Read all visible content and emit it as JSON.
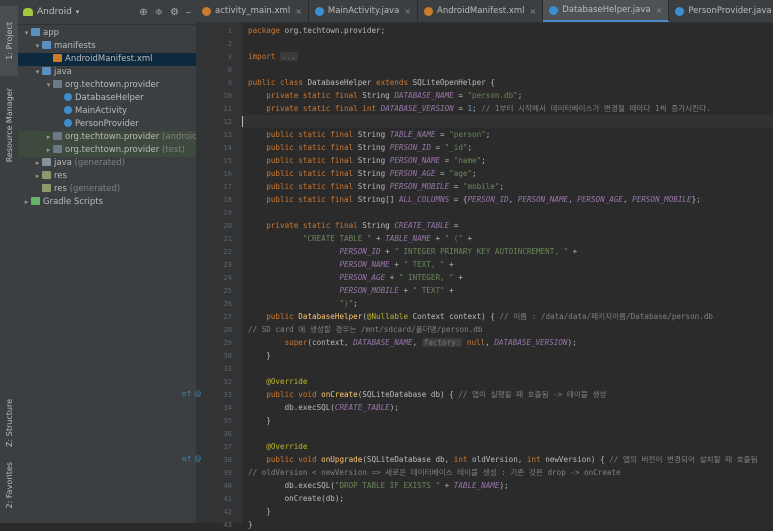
{
  "sidebar_tabs": {
    "project": "1: Project",
    "resource_manager": "Resource Manager",
    "structure": "Z: Structure",
    "favorites": "2: Favorites"
  },
  "project_panel": {
    "view_selector": "Android",
    "tree": [
      {
        "label": "app",
        "indent": 0,
        "arrow": "▾",
        "icon": "folder blue"
      },
      {
        "label": "manifests",
        "indent": 1,
        "arrow": "▾",
        "icon": "folder blue"
      },
      {
        "label": "AndroidManifest.xml",
        "indent": 2,
        "arrow": "",
        "icon": "xml",
        "selected": true
      },
      {
        "label": "java",
        "indent": 1,
        "arrow": "▾",
        "icon": "folder blue"
      },
      {
        "label": "org.techtown.provider",
        "indent": 2,
        "arrow": "▾",
        "icon": "pkg"
      },
      {
        "label": "DatabaseHelper",
        "indent": 3,
        "arrow": "",
        "icon": "cls"
      },
      {
        "label": "MainActivity",
        "indent": 3,
        "arrow": "",
        "icon": "cls"
      },
      {
        "label": "PersonProvider",
        "indent": 3,
        "arrow": "",
        "icon": "cls"
      },
      {
        "label": "org.techtown.provider",
        "suffix": "(androidTest)",
        "indent": 2,
        "arrow": "▸",
        "icon": "pkg",
        "gray": true
      },
      {
        "label": "org.techtown.provider",
        "suffix": "(test)",
        "indent": 2,
        "arrow": "▸",
        "icon": "pkg",
        "gray": true
      },
      {
        "label": "java",
        "suffix": "(generated)",
        "indent": 1,
        "arrow": "▸",
        "icon": "folder"
      },
      {
        "label": "res",
        "indent": 1,
        "arrow": "▸",
        "icon": "res"
      },
      {
        "label": "res",
        "suffix": "(generated)",
        "indent": 1,
        "arrow": "",
        "icon": "res"
      },
      {
        "label": "Gradle Scripts",
        "indent": 0,
        "arrow": "▸",
        "icon": "gradle"
      }
    ]
  },
  "tabs": [
    {
      "label": "activity_main.xml",
      "color": "#c97c2b"
    },
    {
      "label": "MainActivity.java",
      "color": "#3b8ed0"
    },
    {
      "label": "AndroidManifest.xml",
      "color": "#c97c2b"
    },
    {
      "label": "DatabaseHelper.java",
      "color": "#3b8ed0",
      "active": true
    },
    {
      "label": "PersonProvider.java",
      "color": "#3b8ed0"
    }
  ],
  "code_lines": [
    {
      "n": "1",
      "parts": [
        [
          "kw",
          "package "
        ],
        [
          "",
          "org.techtown.provider;"
        ]
      ]
    },
    {
      "n": "2",
      "parts": []
    },
    {
      "n": "3",
      "parts": [
        [
          "kw",
          "import "
        ],
        [
          "hint",
          "..."
        ]
      ]
    },
    {
      "n": "8",
      "parts": []
    },
    {
      "n": "9",
      "parts": [
        [
          "kw",
          "public class "
        ],
        [
          "",
          "DatabaseHelper "
        ],
        [
          "kw",
          "extends "
        ],
        [
          "",
          "SQLiteOpenHelper {"
        ]
      ]
    },
    {
      "n": "10",
      "parts": [
        [
          "kw",
          "    private static final "
        ],
        [
          "",
          "String "
        ],
        [
          "cst",
          "DATABASE_NAME"
        ],
        [
          "",
          " = "
        ],
        [
          "str",
          "\"person.db\""
        ],
        [
          "",
          ";"
        ]
      ]
    },
    {
      "n": "11",
      "parts": [
        [
          "kw",
          "    private static final int "
        ],
        [
          "cst",
          "DATABASE_VERSION"
        ],
        [
          "",
          " = "
        ],
        [
          "num",
          "1"
        ],
        [
          "",
          ";"
        ],
        [
          "cm",
          " // 1부터 시작해서 데이터베이스가 변경될 때마다 1씩 증가시킨다."
        ]
      ]
    },
    {
      "n": "12",
      "parts": [],
      "current": true
    },
    {
      "n": "13",
      "parts": [
        [
          "kw",
          "    public static final "
        ],
        [
          "",
          "String "
        ],
        [
          "cst",
          "TABLE_NAME"
        ],
        [
          "",
          " = "
        ],
        [
          "str",
          "\"person\""
        ],
        [
          "",
          ";"
        ]
      ]
    },
    {
      "n": "14",
      "parts": [
        [
          "kw",
          "    public static final "
        ],
        [
          "",
          "String "
        ],
        [
          "cst",
          "PERSON_ID"
        ],
        [
          "",
          " = "
        ],
        [
          "str",
          "\"_id\""
        ],
        [
          "",
          ";"
        ]
      ]
    },
    {
      "n": "15",
      "parts": [
        [
          "kw",
          "    public static final "
        ],
        [
          "",
          "String "
        ],
        [
          "cst",
          "PERSON_NAME"
        ],
        [
          "",
          " = "
        ],
        [
          "str",
          "\"name\""
        ],
        [
          "",
          ";"
        ]
      ]
    },
    {
      "n": "16",
      "parts": [
        [
          "kw",
          "    public static final "
        ],
        [
          "",
          "String "
        ],
        [
          "cst",
          "PERSON_AGE"
        ],
        [
          "",
          " = "
        ],
        [
          "str",
          "\"age\""
        ],
        [
          "",
          ";"
        ]
      ]
    },
    {
      "n": "17",
      "parts": [
        [
          "kw",
          "    public static final "
        ],
        [
          "",
          "String "
        ],
        [
          "cst",
          "PERSON_MOBILE"
        ],
        [
          "",
          " = "
        ],
        [
          "str",
          "\"mobile\""
        ],
        [
          "",
          ";"
        ]
      ]
    },
    {
      "n": "18",
      "parts": [
        [
          "kw",
          "    public static final "
        ],
        [
          "",
          "String[] "
        ],
        [
          "cst",
          "ALL_COLUMNS"
        ],
        [
          "",
          " = {"
        ],
        [
          "cst",
          "PERSON_ID"
        ],
        [
          "",
          ", "
        ],
        [
          "cst",
          "PERSON_NAME"
        ],
        [
          "",
          ", "
        ],
        [
          "cst",
          "PERSON_AGE"
        ],
        [
          "",
          ", "
        ],
        [
          "cst",
          "PERSON_MOBILE"
        ],
        [
          "",
          "};"
        ]
      ]
    },
    {
      "n": "19",
      "parts": []
    },
    {
      "n": "20",
      "parts": [
        [
          "kw",
          "    private static final "
        ],
        [
          "",
          "String "
        ],
        [
          "cst",
          "CREATE_TABLE"
        ],
        [
          "",
          " ="
        ]
      ]
    },
    {
      "n": "21",
      "parts": [
        [
          "",
          "            "
        ],
        [
          "str",
          "\"CREATE TABLE \""
        ],
        [
          "",
          " + "
        ],
        [
          "cst",
          "TABLE_NAME"
        ],
        [
          "",
          " + "
        ],
        [
          "str",
          "\" (\""
        ],
        [
          "",
          " +"
        ]
      ]
    },
    {
      "n": "22",
      "parts": [
        [
          "",
          "                    "
        ],
        [
          "cst",
          "PERSON_ID"
        ],
        [
          "",
          " + "
        ],
        [
          "str",
          "\" INTEGER PRIMARY KEY AUTOINCREMENT, \""
        ],
        [
          "",
          " +"
        ]
      ]
    },
    {
      "n": "23",
      "parts": [
        [
          "",
          "                    "
        ],
        [
          "cst",
          "PERSON_NAME"
        ],
        [
          "",
          " + "
        ],
        [
          "str",
          "\" TEXT, \""
        ],
        [
          "",
          " +"
        ]
      ]
    },
    {
      "n": "24",
      "parts": [
        [
          "",
          "                    "
        ],
        [
          "cst",
          "PERSON_AGE"
        ],
        [
          "",
          " + "
        ],
        [
          "str",
          "\" INTEGER, \""
        ],
        [
          "",
          " +"
        ]
      ]
    },
    {
      "n": "25",
      "parts": [
        [
          "",
          "                    "
        ],
        [
          "cst",
          "PERSON_MOBILE"
        ],
        [
          "",
          " + "
        ],
        [
          "str",
          "\" TEXT\""
        ],
        [
          "",
          " +"
        ]
      ]
    },
    {
      "n": "26",
      "parts": [
        [
          "",
          "                    "
        ],
        [
          "str",
          "\")\""
        ],
        [
          "",
          ";"
        ]
      ]
    },
    {
      "n": "27",
      "parts": [
        [
          "kw",
          "    public "
        ],
        [
          "fn",
          "DatabaseHelper"
        ],
        [
          "",
          "("
        ],
        [
          "ann",
          "@Nullable "
        ],
        [
          "",
          "Context context) {"
        ],
        [
          "cm",
          " // 이름 : /data/data/패키지이름/Database/person.db"
        ]
      ]
    },
    {
      "n": "28",
      "parts": [
        [
          "cm",
          "// SD card 에 생성할 경우는 /mnt/sdcard/폴더명/person.db"
        ]
      ]
    },
    {
      "n": "29",
      "parts": [
        [
          "kw",
          "        super"
        ],
        [
          "",
          "(context, "
        ],
        [
          "cst",
          "DATABASE_NAME"
        ],
        [
          "",
          ", "
        ],
        [
          "hint",
          "factory:"
        ],
        [
          "kw",
          " null"
        ],
        [
          "",
          ", "
        ],
        [
          "cst",
          "DATABASE_VERSION"
        ],
        [
          "",
          ");"
        ]
      ]
    },
    {
      "n": "30",
      "parts": [
        [
          "",
          "    }"
        ]
      ]
    },
    {
      "n": "31",
      "parts": []
    },
    {
      "n": "32",
      "parts": [
        [
          "ann",
          "    @Override"
        ]
      ]
    },
    {
      "n": "33",
      "parts": [
        [
          "kw",
          "    public void "
        ],
        [
          "fn",
          "onCreate"
        ],
        [
          "",
          "(SQLiteDatabase db) {"
        ],
        [
          "cm",
          " // 앱이 실행될 때 호출됨 -> 테이블 생성"
        ]
      ],
      "mark": "o↑ @"
    },
    {
      "n": "34",
      "parts": [
        [
          "",
          "        db.execSQL("
        ],
        [
          "cst",
          "CREATE_TABLE"
        ],
        [
          "",
          ");"
        ]
      ]
    },
    {
      "n": "35",
      "parts": [
        [
          "",
          "    }"
        ]
      ]
    },
    {
      "n": "36",
      "parts": []
    },
    {
      "n": "37",
      "parts": [
        [
          "ann",
          "    @Override"
        ]
      ]
    },
    {
      "n": "38",
      "parts": [
        [
          "kw",
          "    public void "
        ],
        [
          "fn",
          "onUpgrade"
        ],
        [
          "",
          "(SQLiteDatabase db, "
        ],
        [
          "kw",
          "int "
        ],
        [
          "",
          "oldVersion, "
        ],
        [
          "kw",
          "int "
        ],
        [
          "",
          "newVersion) {"
        ],
        [
          "cm",
          " // 앱의 버전이 변경되어 설치될 때 호출됨"
        ]
      ],
      "mark": "o↑ @"
    },
    {
      "n": "39",
      "parts": [
        [
          "cm",
          "// oldVersion < newVersion => 새로운 데이터베이스 테이블 생성 : 기존 것은 drop -> onCreate"
        ]
      ]
    },
    {
      "n": "40",
      "parts": [
        [
          "",
          "        db.execSQL("
        ],
        [
          "str",
          "\"DROP TABLE IF EXISTS \""
        ],
        [
          "",
          " + "
        ],
        [
          "cst",
          "TABLE_NAME"
        ],
        [
          "",
          ");"
        ]
      ]
    },
    {
      "n": "41",
      "parts": [
        [
          "",
          "        onCreate(db);"
        ]
      ]
    },
    {
      "n": "42",
      "parts": [
        [
          "",
          "    }"
        ]
      ]
    },
    {
      "n": "43",
      "parts": [
        [
          "",
          "}"
        ]
      ]
    }
  ]
}
